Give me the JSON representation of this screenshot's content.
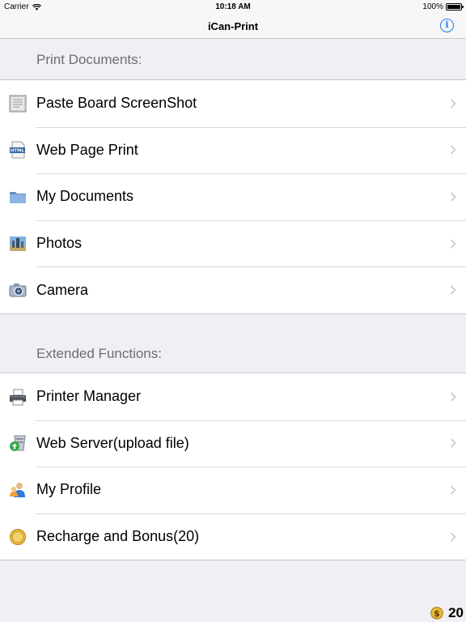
{
  "status_bar": {
    "carrier": "Carrier",
    "time": "10:18 AM",
    "battery": "100%"
  },
  "nav": {
    "title": "iCan-Print",
    "info_icon": "info-icon"
  },
  "sections": [
    {
      "header": "Print Documents:",
      "items": [
        {
          "label": "Paste Board ScreenShot",
          "icon": "clipboard-icon"
        },
        {
          "label": "Web Page Print",
          "icon": "html-file-icon"
        },
        {
          "label": "My Documents",
          "icon": "folder-icon"
        },
        {
          "label": "Photos",
          "icon": "photos-icon"
        },
        {
          "label": "Camera",
          "icon": "camera-icon"
        }
      ]
    },
    {
      "header": "Extended Functions:",
      "items": [
        {
          "label": "Printer Manager",
          "icon": "printer-icon"
        },
        {
          "label": "Web Server(upload file)",
          "icon": "server-upload-icon"
        },
        {
          "label": "My Profile",
          "icon": "profile-icon"
        },
        {
          "label": "Recharge and Bonus(20)",
          "icon": "coin-icon"
        }
      ]
    }
  ],
  "coins": {
    "count": "20",
    "icon": "dollar-coin-icon"
  },
  "colors": {
    "accent": "#1a7ef7",
    "background": "#efeff4",
    "header_text": "#6d6d72",
    "separator": "#c8c7cc"
  }
}
